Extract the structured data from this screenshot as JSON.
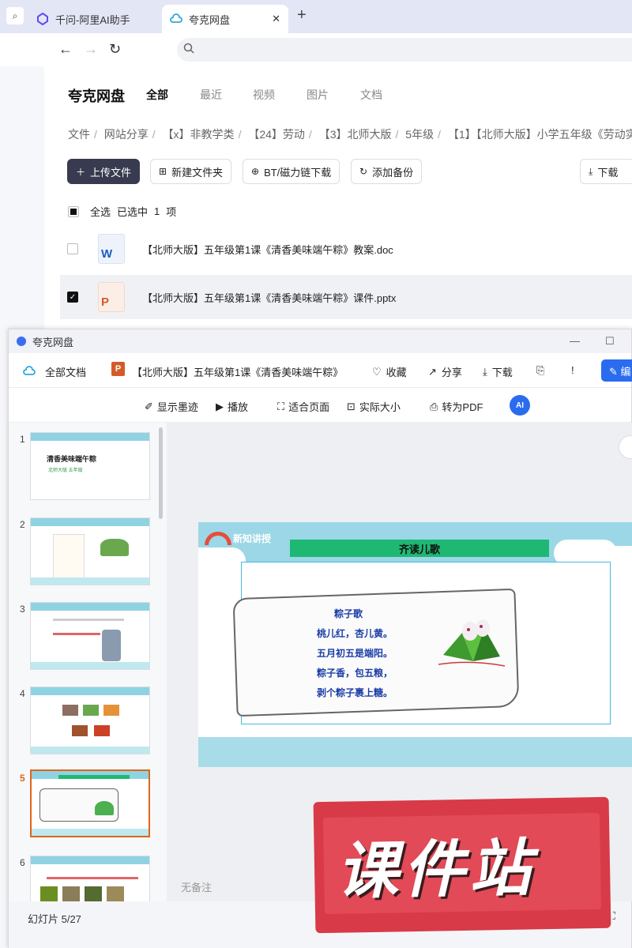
{
  "browser": {
    "tabs": [
      {
        "label": "千问-阿里AI助手"
      },
      {
        "label": "夸克网盘"
      }
    ]
  },
  "header": {
    "brand": "夸克网盘",
    "nav": [
      "全部",
      "最近",
      "视频",
      "图片",
      "文档"
    ]
  },
  "breadcrumb": [
    "文件",
    "网站分享",
    "【x】非教学类",
    "【24】劳动",
    "【3】北师大版",
    "5年级",
    "【1】【北师大版】小学五年级《劳动实"
  ],
  "actions": {
    "upload": "上传文件",
    "new_folder": "新建文件夹",
    "bt_download": "BT/磁力链下载",
    "add_backup": "添加备份",
    "download": "下载"
  },
  "selection": {
    "select_all": "全选",
    "selected_prefix": "已选中",
    "count": "1",
    "unit": "项"
  },
  "files": [
    {
      "name": "【北师大版】五年级第1课《清香美味端午粽》教案.doc",
      "icon_letter": "W",
      "selected": false
    },
    {
      "name": "【北师大版】五年级第1课《清香美味端午粽》课件.pptx",
      "icon_letter": "P",
      "selected": true
    }
  ],
  "viewer": {
    "window_title": "夸克网盘",
    "all_docs": "全部文档",
    "file_title": "【北师大版】五年级第1课《清香美味端午粽》",
    "collect": "收藏",
    "share": "分享",
    "download": "下载",
    "edit": "编",
    "show_ink": "显示墨迹",
    "play": "播放",
    "fit_page": "适合页面",
    "actual_size": "实际大小",
    "to_pdf": "转为PDF",
    "ai": "AI",
    "notes_placeholder": "无备注",
    "slide_counter": "幻灯片 5/27",
    "thumbnails": [
      {
        "num": "1",
        "title": "清香美味端午粽",
        "subtitle": "北师大版    五年级"
      },
      {
        "num": "2",
        "title": "",
        "subtitle": ""
      },
      {
        "num": "3",
        "title": "",
        "subtitle": ""
      },
      {
        "num": "4",
        "title": "",
        "subtitle": ""
      },
      {
        "num": "5",
        "title": "",
        "subtitle": ""
      },
      {
        "num": "6",
        "title": "",
        "subtitle": ""
      }
    ],
    "slide": {
      "tag": "新知讲授",
      "banner": "齐读儿歌",
      "poem_title": "粽子歌",
      "poem_lines": [
        "桃儿红，杏儿黄。",
        "五月初五是端阳。",
        "粽子香，包五粮，",
        "剥个粽子裹上糖。"
      ]
    }
  },
  "watermark": "课件站"
}
